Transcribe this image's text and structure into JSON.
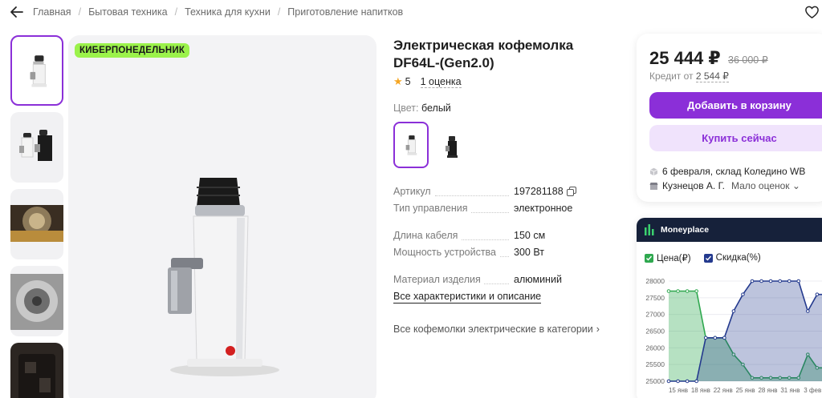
{
  "breadcrumb": [
    "Главная",
    "Бытовая техника",
    "Техника для кухни",
    "Приготовление напитков"
  ],
  "promo_badge": "КИБЕРПОНЕДЕЛЬНИК",
  "product": {
    "title": "Электрическая кофемолка DF64L-(Gen2.0)",
    "rating": "5",
    "reviews": "1 оценка",
    "color_label": "Цвет:",
    "color_value": "белый"
  },
  "specs": [
    {
      "k": "Артикул",
      "v": "197281188"
    },
    {
      "k": "Тип управления",
      "v": "электронное"
    },
    {
      "k": "Длина кабеля",
      "v": "150 см"
    },
    {
      "k": "Мощность устройства",
      "v": "300 Вт"
    },
    {
      "k": "Материал изделия",
      "v": "алюминий"
    }
  ],
  "links": {
    "all_specs": "Все характеристики и описание",
    "category": "Все кофемолки электрические в категории"
  },
  "buy": {
    "price": "25 444 ₽",
    "old_price": "36 000 ₽",
    "credit_prefix": "Кредит от",
    "credit_amount": "2 544 ₽",
    "add_to_cart": "Добавить в корзину",
    "buy_now": "Купить сейчас",
    "delivery": "6 февраля, склад Коледино WB",
    "seller": "Кузнецов А. Г.",
    "seller_reviews": "Мало оценок"
  },
  "moneyplace": {
    "name": "Moneyplace",
    "legend_price": "Цена(₽)",
    "legend_discount": "Скидка(%)",
    "price_color": "#2fa84f",
    "discount_color": "#243a8e"
  },
  "chart_data": {
    "type": "area",
    "x": [
      "15 янв",
      "18 янв",
      "22 янв",
      "25 янв",
      "28 янв",
      "31 янв",
      "3 фев"
    ],
    "y_ticks": [
      "28000",
      "27500",
      "27000",
      "26500",
      "26000",
      "25500",
      "25000"
    ],
    "ylim": [
      25000,
      28000
    ],
    "series": [
      {
        "name": "Цена(₽)",
        "values": [
          27700,
          27700,
          27700,
          27700,
          26300,
          26300,
          26300,
          25800,
          25500,
          25100,
          25100,
          25100,
          25100,
          25100,
          25100,
          25800,
          25400,
          25400,
          25400
        ]
      },
      {
        "name": "Скидка(%)",
        "values": [
          25000,
          25000,
          25000,
          25000,
          26300,
          26300,
          26300,
          27100,
          27600,
          28000,
          28000,
          28000,
          28000,
          28000,
          28000,
          27100,
          27600,
          27600,
          27600
        ]
      }
    ]
  }
}
